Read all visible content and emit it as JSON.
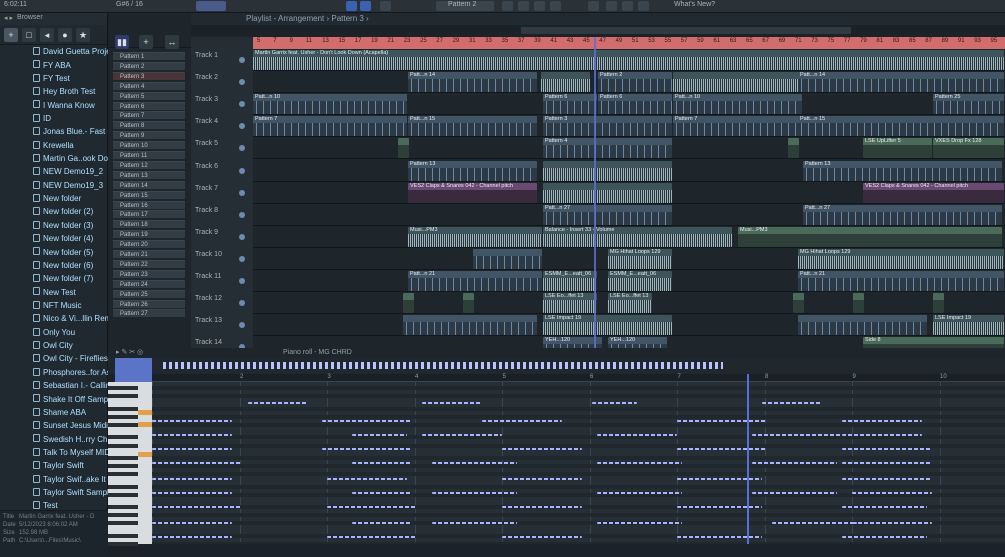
{
  "topbar": {
    "time": "6:02:11",
    "mid_label": "G#6 / 16",
    "pattern": "Pattern 2",
    "whats_new": "What's New?"
  },
  "browser": {
    "title": "Browser",
    "tools": [
      "+",
      "□",
      "◂",
      "●",
      "★"
    ],
    "items": [
      "David Guetta Project",
      "FY ABA",
      "FY Test",
      "Hey Broth Test",
      "I Wanna Know",
      "ID",
      "Jonas Blue.- Fast Car",
      "Krewella",
      "Martin Ga..ook Down",
      "NEW Demo19_2",
      "NEW Demo19_3",
      "New folder",
      "New folder (2)",
      "New folder (3)",
      "New folder (4)",
      "New folder (5)",
      "New folder (6)",
      "New folder (7)",
      "New Test",
      "NFT Music",
      "Nico & Vi...llin Remix)",
      "Only You",
      "Owl City",
      "Owl City - Fireflies",
      "Phosphores..for Asia",
      "Sebastian I.- Calling",
      "Shake It Off Samples",
      "Shame ABA",
      "Sunset Jesus Midi",
      "Swedish H..rry Child",
      "Talk To Myself MIDI",
      "Taylor Swift",
      "Taylor Swif..ake It Off",
      "Taylor Swift Sample",
      "Test"
    ],
    "info": {
      "title_label": "Title",
      "title": "Martin Garrix feat. Usher - D",
      "date_label": "Date",
      "date": "5/12/2023 8:06:02 AM",
      "size_label": "Size",
      "size": "152.98 MB",
      "path_label": "Path",
      "path": "C:\\Users\\...Files\\Music\\"
    }
  },
  "patterns": [
    "Pattern 1",
    "Pattern 2",
    "Pattern 3",
    "Pattern 4",
    "Pattern 5",
    "Pattern 6",
    "Pattern 7",
    "Pattern 8",
    "Pattern 9",
    "Pattern 10",
    "Pattern 11",
    "Pattern 12",
    "Pattern 13",
    "Pattern 14",
    "Pattern 15",
    "Pattern 16",
    "Pattern 17",
    "Pattern 18",
    "Pattern 19",
    "Pattern 20",
    "Pattern 21",
    "Pattern 22",
    "Pattern 23",
    "Pattern 24",
    "Pattern 25",
    "Pattern 26",
    "Pattern 27"
  ],
  "playlist": {
    "title": "Playlist - Arrangement › Pattern 3 ›",
    "ruler": [
      "5",
      "7",
      "9",
      "11",
      "13",
      "15",
      "17",
      "19",
      "21",
      "23",
      "25",
      "27",
      "29",
      "31",
      "33",
      "35",
      "37",
      "39",
      "41",
      "43",
      "45",
      "47",
      "49",
      "51",
      "53",
      "55",
      "57",
      "59",
      "61",
      "63",
      "65",
      "67",
      "69",
      "71",
      "73",
      "75",
      "77",
      "79",
      "81",
      "83",
      "85",
      "87",
      "89",
      "91",
      "93",
      "95"
    ],
    "tracks": [
      "Track 1",
      "Track 2",
      "Track 3",
      "Track 4",
      "Track 5",
      "Track 6",
      "Track 7",
      "Track 8",
      "Track 9",
      "Track 10",
      "Track 11",
      "Track 12",
      "Track 13",
      "Track 14"
    ],
    "clip_labels": {
      "t1": "Martin Garrix feat. Usher - Don't Look Down (Acapella)",
      "t2a": "Patt...n 14",
      "t2b": "Pattern 2",
      "t3a": "Patt...n 10",
      "t3b": "Pattern 6",
      "t3c": "Pattern 25",
      "t4a": "Pattern 7",
      "t4b": "Patt...n 15",
      "t4c": "Pattern 3",
      "t5a": "Pattern 4",
      "t5b": "LSE UpLifter 5",
      "t5c": "VXES Drop Fx 128",
      "t6": "Pattern 13",
      "t7a": "VES2 Claps & Snares 042 - Channel pitch",
      "t7b": "VES2 Claps & Snares 042 - Channel pitch",
      "t8": "Patt...n 27",
      "t9a": "Musi...PM3",
      "t9b": "Balance - Insert 33 - Volume",
      "t10": "MG Hihat Loops 129",
      "t11a": "Patt...n 21",
      "t11b": "ESMM_E...eatt_06",
      "t11c": "ESMM_E...eatt_06",
      "t12": "LSE Eo...ffet 13",
      "t13a": "LSE Impact 19",
      "t13b": "LSE Impact 19",
      "t14a": "YEH...120",
      "t14b": "Side 8"
    }
  },
  "piano_roll": {
    "title": "Piano roll - MG CHRD",
    "ruler": [
      "2",
      "3",
      "4",
      "5",
      "6",
      "7",
      "8",
      "9",
      "10"
    ]
  }
}
